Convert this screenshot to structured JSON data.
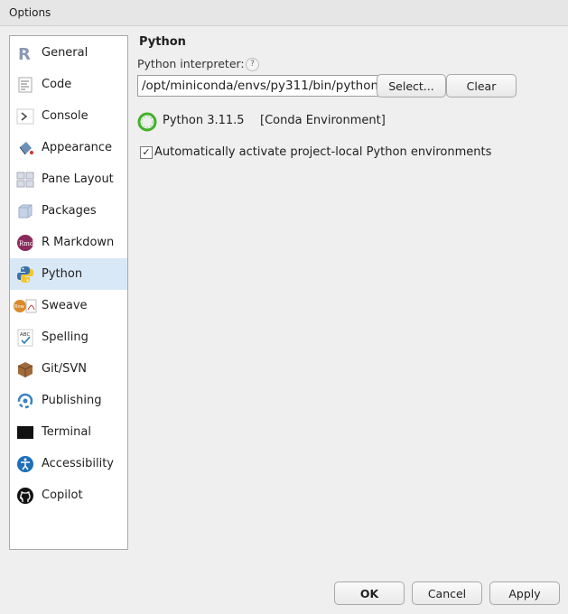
{
  "window": {
    "title": "Options"
  },
  "sidebar": {
    "items": [
      {
        "label": "General",
        "icon": "r-logo-icon"
      },
      {
        "label": "Code",
        "icon": "code-document-icon"
      },
      {
        "label": "Console",
        "icon": "console-prompt-icon"
      },
      {
        "label": "Appearance",
        "icon": "paint-bucket-icon"
      },
      {
        "label": "Pane Layout",
        "icon": "pane-layout-icon"
      },
      {
        "label": "Packages",
        "icon": "package-box-icon"
      },
      {
        "label": "R Markdown",
        "icon": "rmd-icon"
      },
      {
        "label": "Python",
        "icon": "python-logo-icon",
        "selected": true
      },
      {
        "label": "Sweave",
        "icon": "sweave-pdf-icon"
      },
      {
        "label": "Spelling",
        "icon": "abc-spellcheck-icon"
      },
      {
        "label": "Git/SVN",
        "icon": "git-box-icon"
      },
      {
        "label": "Publishing",
        "icon": "publish-icon"
      },
      {
        "label": "Terminal",
        "icon": "terminal-icon"
      },
      {
        "label": "Accessibility",
        "icon": "accessibility-icon"
      },
      {
        "label": "Copilot",
        "icon": "github-logo-icon"
      }
    ]
  },
  "python": {
    "section_title": "Python",
    "interpreter_label": "Python interpreter:",
    "help": "?",
    "interpreter_path": "/opt/miniconda/envs/py311/bin/python",
    "select_label": "Select...",
    "clear_label": "Clear",
    "env_version": "Python 3.11.5",
    "env_type": "[Conda Environment]",
    "auto_activate_label": "Automatically activate project-local Python environments",
    "auto_activate_checked": true
  },
  "footer": {
    "ok_label": "OK",
    "cancel_label": "Cancel",
    "apply_label": "Apply"
  },
  "colors": {
    "selected_bg": "#d9e8f7",
    "conda_green": "#43b02a"
  }
}
